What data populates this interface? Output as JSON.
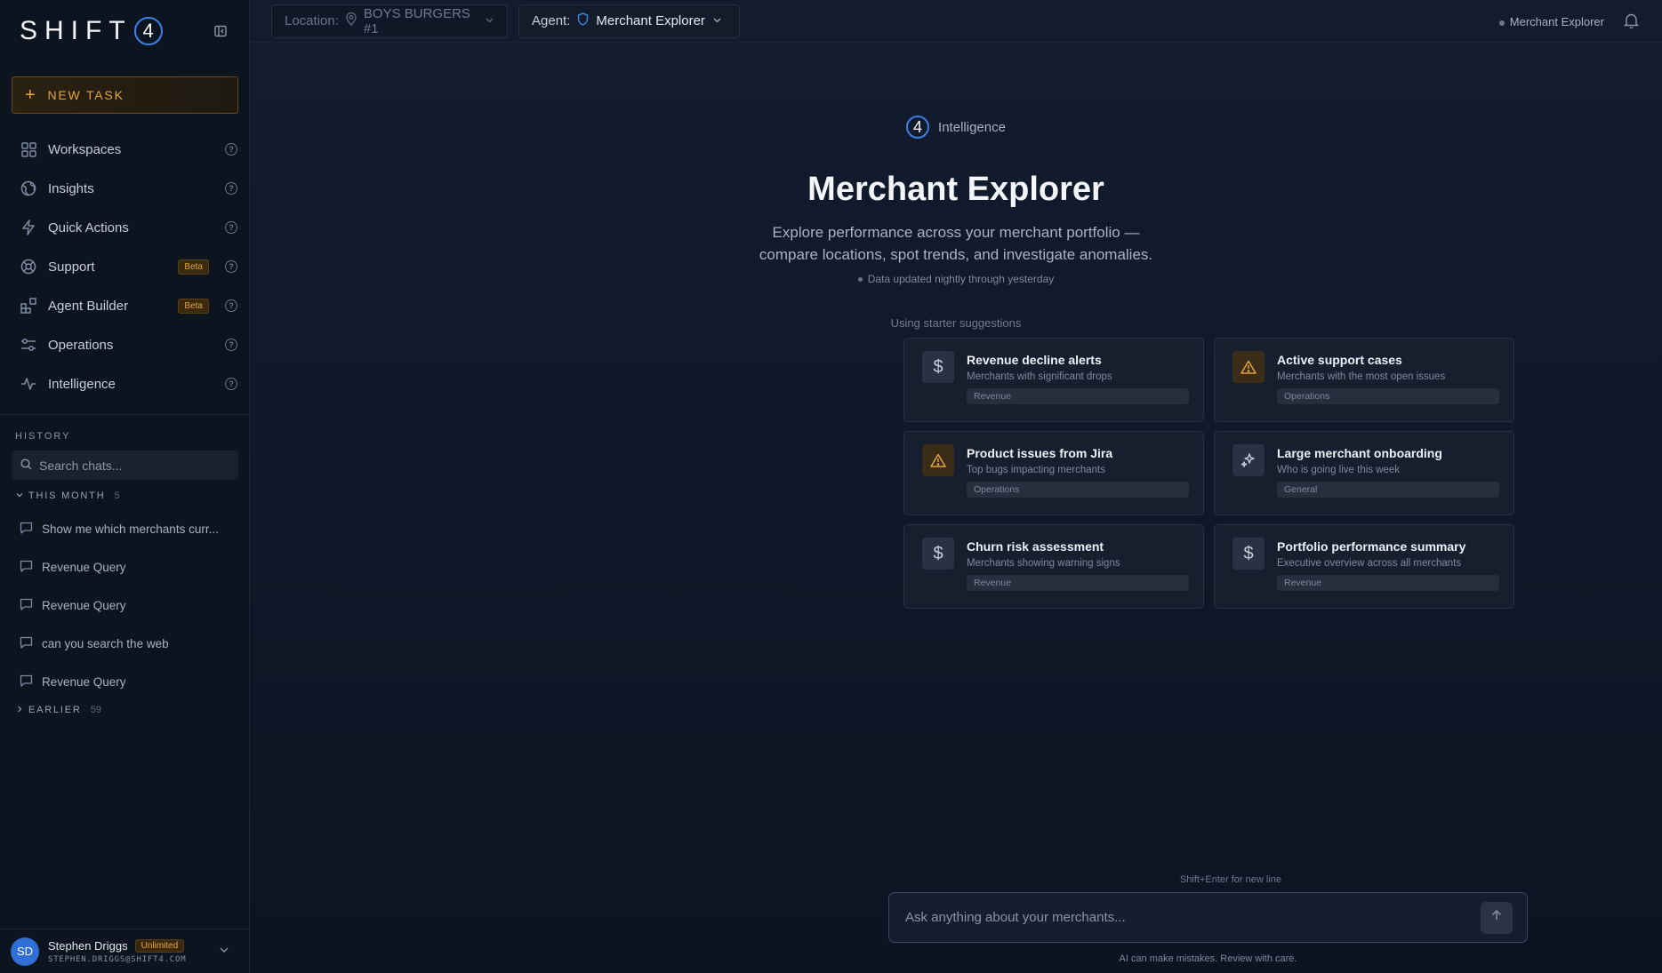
{
  "brand": {
    "logo_text": "SHIFT",
    "logo_num": "4"
  },
  "sidebar": {
    "new_task": "NEW TASK",
    "nav": [
      {
        "label": "Workspaces",
        "icon": "grid-icon"
      },
      {
        "label": "Insights",
        "icon": "globe-icon"
      },
      {
        "label": "Quick Actions",
        "icon": "bolt-icon"
      },
      {
        "label": "Support",
        "icon": "lifebuoy-icon",
        "badge": "Beta"
      },
      {
        "label": "Agent Builder",
        "icon": "blocks-icon",
        "badge": "Beta"
      },
      {
        "label": "Operations",
        "icon": "sliders-icon"
      },
      {
        "label": "Intelligence",
        "icon": "activity-icon"
      }
    ],
    "history_title": "HISTORY",
    "search_placeholder": "Search chats...",
    "this_month": {
      "label": "THIS MONTH",
      "count": "5"
    },
    "chats": [
      "Show me which merchants curr...",
      "Revenue Query",
      "Revenue Query",
      "can you search the web",
      "Revenue Query"
    ],
    "earlier": {
      "label": "EARLIER",
      "count": "59"
    }
  },
  "user": {
    "initials": "SD",
    "name": "Stephen Driggs",
    "plan": "Unlimited",
    "email": "STEPHEN.DRIGGS@SHIFT4.COM"
  },
  "topbar": {
    "location_label": "Location:",
    "location_value": "BOYS BURGERS #1",
    "agent_label": "Agent:",
    "agent_value": "Merchant Explorer",
    "status": "Merchant Explorer"
  },
  "hero": {
    "badge": "Intelligence",
    "badge_num": "4",
    "title": "Merchant Explorer",
    "subtitle_1": "Explore performance across your merchant portfolio —",
    "subtitle_2": "compare locations, spot trends, and investigate anomalies.",
    "updated": "Data updated nightly through yesterday",
    "starter_label": "Using starter suggestions"
  },
  "cards": [
    {
      "title": "Revenue decline alerts",
      "desc": "Merchants with significant drops",
      "tag": "Revenue",
      "icon": "dollar-icon",
      "warn": false
    },
    {
      "title": "Active support cases",
      "desc": "Merchants with the most open issues",
      "tag": "Operations",
      "icon": "warning-icon",
      "warn": true
    },
    {
      "title": "Product issues from Jira",
      "desc": "Top bugs impacting merchants",
      "tag": "Operations",
      "icon": "warning-icon",
      "warn": true
    },
    {
      "title": "Large merchant onboarding",
      "desc": "Who is going live this week",
      "tag": "General",
      "icon": "sparkle-icon",
      "warn": false
    },
    {
      "title": "Churn risk assessment",
      "desc": "Merchants showing warning signs",
      "tag": "Revenue",
      "icon": "dollar-icon",
      "warn": false
    },
    {
      "title": "Portfolio performance summary",
      "desc": "Executive overview across all merchants",
      "tag": "Revenue",
      "icon": "dollar-icon",
      "warn": false
    }
  ],
  "composer": {
    "hint": "Shift+Enter for new line",
    "placeholder": "Ask anything about your merchants...",
    "disclaimer": "AI can make mistakes. Review with care."
  },
  "colors": {
    "accent": "#e4a43a",
    "brand_blue": "#3d7fe8",
    "background": "#0d1524"
  }
}
